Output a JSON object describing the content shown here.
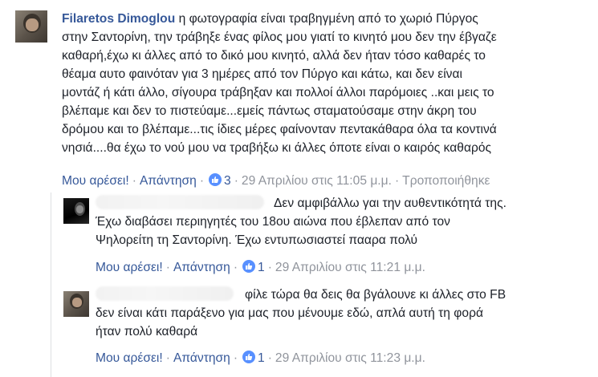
{
  "comments": [
    {
      "author": "Filaretos Dimoglou",
      "lines": [
        " η φωτογραφία είναι τραβηγμένη από το χωριό Πύργος",
        "στην Σαντορίνη, την τράβηξε ένας φίλος μου γιατί το κινητό μου δεν την έβγαζε",
        "καθαρή,έχω κι άλλες από το δικό μου κινητό, αλλά δεν ήταν τόσο καθαρές το",
        "θέαμα αυτο φαινόταν για 3 ημέρες από τον Πύργο και κάτω, και δεν είναι",
        "μοντάζ ή κάτι άλλο, σίγουρα τράβηξαν και πολλοί άλλοι παρόμοιες ..και μεις το",
        "βλέπαμε και δεν το πιστεύαμε...εμείς πάντως σταματούσαμε στην άκρη του",
        "δρόμου και το βλέπαμε...τις ίδιες μέρες φαίνοντα​ν πεντακάθαρα όλα τα κοντινά",
        "νησιά....θα έχω το νού μου να τραβήξω κι άλλες όποτε είναι ο καιρός καθαρός"
      ],
      "like_label": "Μου αρέσει!",
      "reply_label": "Απάντηση",
      "like_count": "3",
      "timestamp": "29 Απριλίου στις 11:05 μ.μ.",
      "edited_label": "Τροποποιήθηκε"
    },
    {
      "first_line": "Δεν αμφιβάλλω γαι την αυθεντικότητά της.",
      "lines": [
        "Έχω διαβάσει περιηγητές του 18ου αιώνα που έβλεπαν από τον",
        "Ψηλορείτη τη Σαντορίνη. Έχω εντυπωσιαστεί πααρα πολύ"
      ],
      "like_label": "Μου αρέσει!",
      "reply_label": "Απάντηση",
      "like_count": "1",
      "timestamp": "29 Απριλίου στις 11:21 μ.μ."
    },
    {
      "first_line": "φίλε τώρα θα δεις θα βγάλουνε κι άλλες στο FB",
      "lines": [
        "δεν είναι κάτι παράξενο για μας που μένουμε εδώ, απλά αυτή τη φορά",
        "ήταν πολύ καθαρά"
      ],
      "like_label": "Μου αρέσει!",
      "reply_label": "Απάντηση",
      "like_count": "1",
      "timestamp": "29 Απριλίου στις 11:23 μ.μ."
    }
  ],
  "colors": {
    "link": "#365899",
    "meta": "#90949c",
    "like_badge": "#5890ff",
    "text": "#1d2129"
  },
  "icons": {
    "like": "thumbs-up-icon"
  }
}
